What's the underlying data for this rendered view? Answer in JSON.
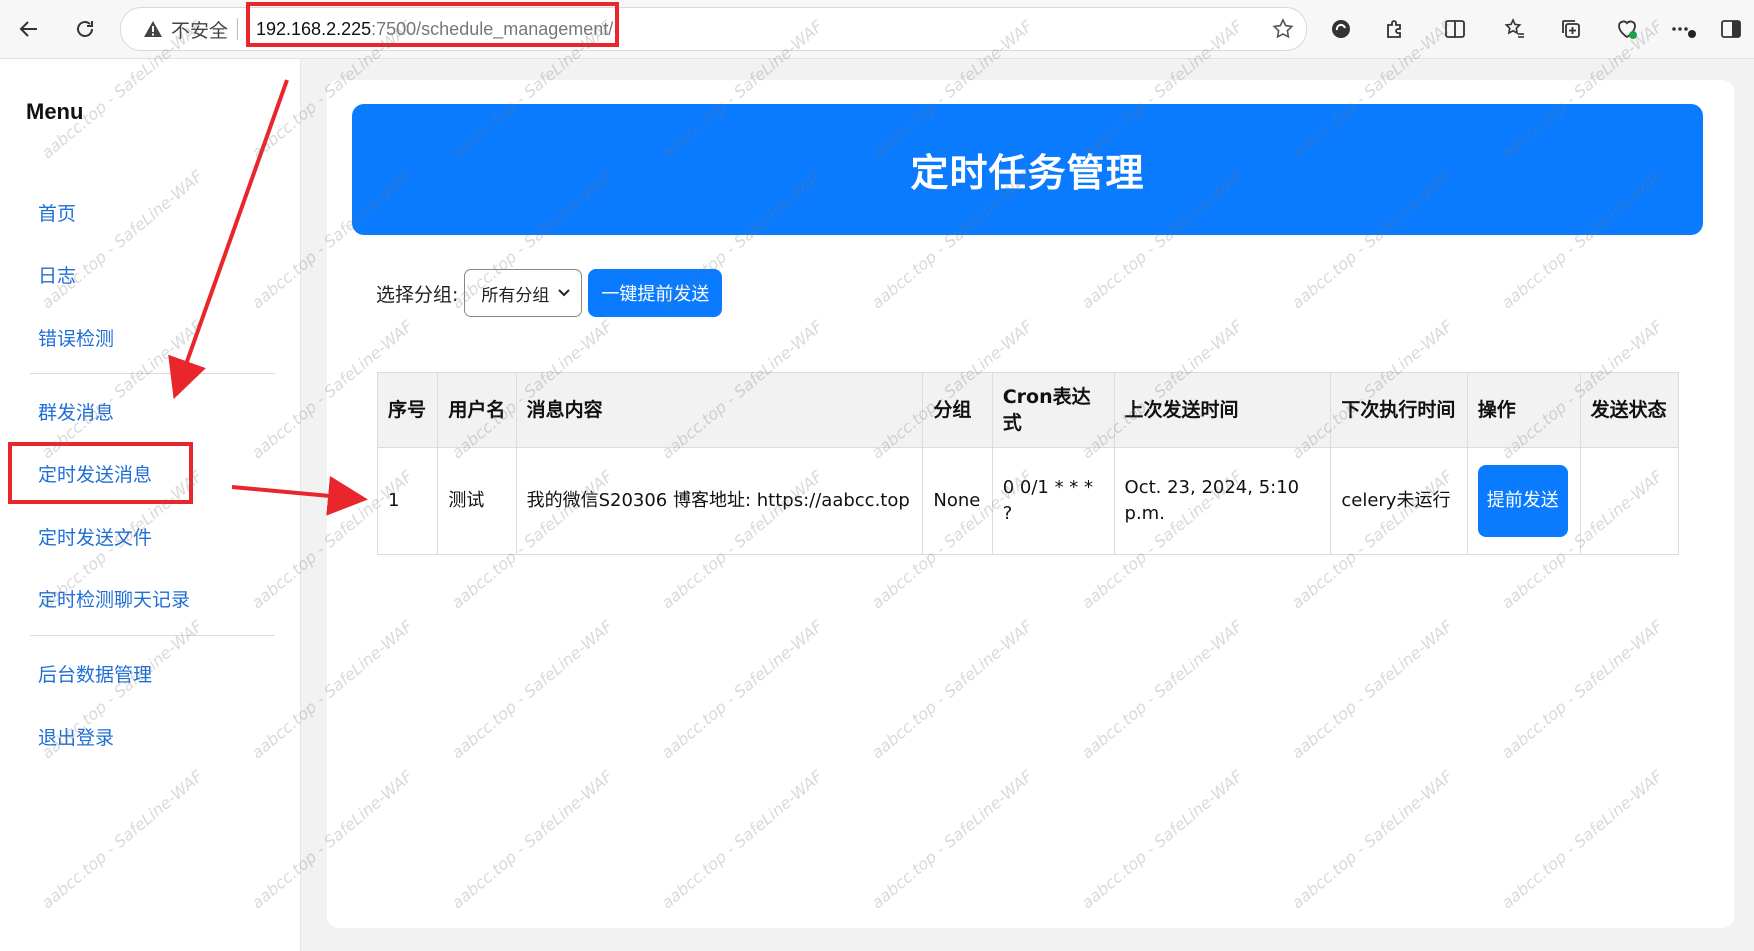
{
  "browser": {
    "insecure_label": "不安全",
    "url_host": "192.168.2.225",
    "url_rest": ":7500/schedule_management/"
  },
  "sidebar": {
    "title": "Menu",
    "items": [
      {
        "label": "首页"
      },
      {
        "label": "日志"
      },
      {
        "label": "错误检测"
      },
      {
        "label": "群发消息"
      },
      {
        "label": "定时发送消息"
      },
      {
        "label": "定时发送文件"
      },
      {
        "label": "定时检测聊天记录"
      },
      {
        "label": "后台数据管理"
      },
      {
        "label": "退出登录"
      }
    ],
    "active_item": "定时发送消息"
  },
  "main": {
    "title": "定时任务管理",
    "filter_label": "选择分组:",
    "group_select_value": "所有分组",
    "send_all_button": "一键提前发送",
    "table": {
      "headers": [
        "序号",
        "用户名",
        "消息内容",
        "分组",
        "Cron表达式",
        "上次发送时间",
        "下次执行时间",
        "操作",
        "发送状态"
      ],
      "rows": [
        {
          "index": "1",
          "username": "测试",
          "message": "我的微信S20306 博客地址: https://aabcc.top",
          "group": "None",
          "cron": "0 0/1 * * * ?",
          "last_sent": "Oct. 23, 2024, 5:10 p.m.",
          "next_run": "celery未运行",
          "action_label": "提前发送",
          "status": ""
        }
      ]
    }
  },
  "watermark_text": "aabcc.top - SafeLine-WAF",
  "colors": {
    "accent": "#0a7bff",
    "link": "#1f6fd6",
    "annotation_red": "#e8262b"
  }
}
